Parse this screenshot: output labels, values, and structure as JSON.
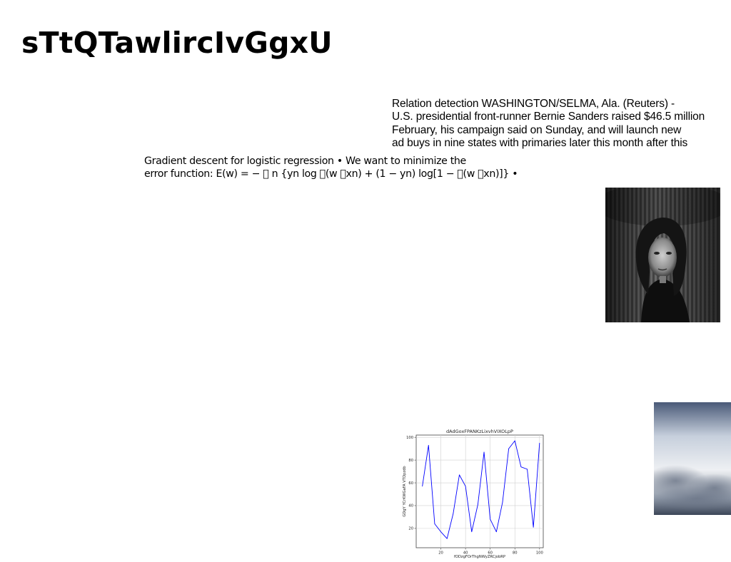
{
  "title": "sTtQTawlircIvGgxU",
  "news": {
    "lines": [
      "Relation detection WASHINGTON/SELMA, Ala. (Reuters) -",
      "U.S. presidential front-runner Bernie Sanders raised $46.5 million",
      "February, his campaign said on Sunday, and will launch new",
      "ad buys in nine states with primaries later this month after this"
    ]
  },
  "gradient": {
    "lines": [
      "Gradient descent for logistic regression • We want to minimize the",
      "error function: E(w) = − \u0000 n {yn log \u0000(w \u0000xn) + (1 − yn) log[1 − \u0000(w \u0000xn)]} •"
    ]
  },
  "images": {
    "portrait": "black-and-white portrait of a young woman",
    "sky": "misty cloudy sky"
  },
  "chart_data": {
    "type": "line",
    "title": "dAdGoxFPANKzLixvhVIXOLpP",
    "xlabel": "fODzgFOrThgNWyZRCjobRP",
    "ylabel": "GDgY YCrKWGaFA VTDpzdb",
    "xlim": [
      0,
      103
    ],
    "ylim": [
      3,
      102
    ],
    "xticks": [
      20,
      40,
      60,
      80,
      100
    ],
    "yticks": [
      20,
      40,
      60,
      80,
      100
    ],
    "grid": true,
    "series": [
      {
        "color": "#0000ff",
        "x": [
          5,
          10,
          15,
          20,
          25,
          30,
          35,
          40,
          45,
          50,
          55,
          60,
          65,
          70,
          75,
          80,
          85,
          90,
          95,
          100
        ],
        "y": [
          57,
          93,
          24,
          17,
          11,
          33,
          67,
          57,
          17,
          41,
          87,
          28,
          17,
          43,
          90,
          97,
          74,
          72,
          21,
          95
        ]
      }
    ]
  }
}
